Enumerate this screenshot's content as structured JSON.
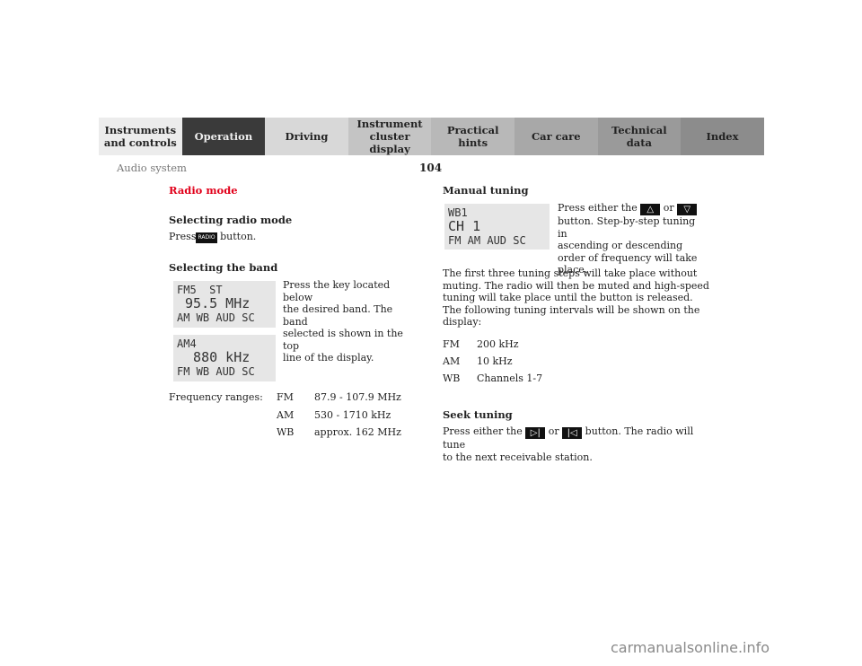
{
  "nav": {
    "tabs": [
      {
        "label": "Instruments\nand controls",
        "l1": "Instruments",
        "l2": "and controls"
      },
      {
        "label": "Operation"
      },
      {
        "label": "Driving"
      },
      {
        "l1": "Instrument",
        "l2": "cluster display"
      },
      {
        "label": "Practical hints"
      },
      {
        "label": "Car care"
      },
      {
        "l1": "Technical",
        "l2": "data"
      },
      {
        "label": "Index"
      }
    ],
    "active": "Operation"
  },
  "header": {
    "section": "Audio system",
    "page": "104"
  },
  "left": {
    "title": "Radio mode",
    "select_mode_heading": "Selecting radio mode",
    "press": "Press",
    "radio_key": "RADIO",
    "button_text": "button.",
    "select_band_heading": "Selecting the band",
    "band_desc_lines": [
      "Press the key located below",
      "the desired band. The band",
      "selected is shown in the top",
      "line of the display."
    ],
    "display1": {
      "l1": "FM5  ST",
      "l2": " 95.5 MHz",
      "l3": "AM WB AUD SC"
    },
    "display2": {
      "l1": "AM4",
      "l2": "  880 kHz",
      "l3": "FM WB AUD SC"
    },
    "freq_label": "Frequency ranges:",
    "freq_rows": [
      {
        "band": "FM",
        "range": "87.9 - 107.9 MHz"
      },
      {
        "band": "AM",
        "range": "530 - 1710 kHz"
      },
      {
        "band": "WB",
        "range": "approx. 162 MHz"
      }
    ]
  },
  "right": {
    "manual_heading": "Manual tuning",
    "display3": {
      "l1": "WB1",
      "l2": "CH 1",
      "l3": "FM AM AUD SC"
    },
    "manual_p1": "Press either the",
    "or": "or",
    "up_key": "△",
    "down_key": "▽",
    "manual_lines": [
      "button. Step-by-step tuning in",
      "ascending or descending",
      "order of frequency will take",
      "place."
    ],
    "body_lines": [
      "The first three tuning steps will take place without",
      "muting. The radio will then be muted and high-speed",
      "tuning will take place until the button is released.",
      "The following tuning intervals will be shown on the",
      "display:"
    ],
    "intervals": [
      {
        "band": "FM",
        "value": "200 kHz"
      },
      {
        "band": "AM",
        "value": "10 kHz"
      },
      {
        "band": "WB",
        "value": "Channels 1-7"
      }
    ],
    "seek_heading": "Seek tuning",
    "seek_p1": "Press either the",
    "seek_fwd": "▷|",
    "seek_or": "or",
    "seek_back": "|◁",
    "seek_p2": "button. The radio will tune",
    "seek_line2": "to the next receivable station."
  },
  "watermark": "carmanualsonline.info"
}
